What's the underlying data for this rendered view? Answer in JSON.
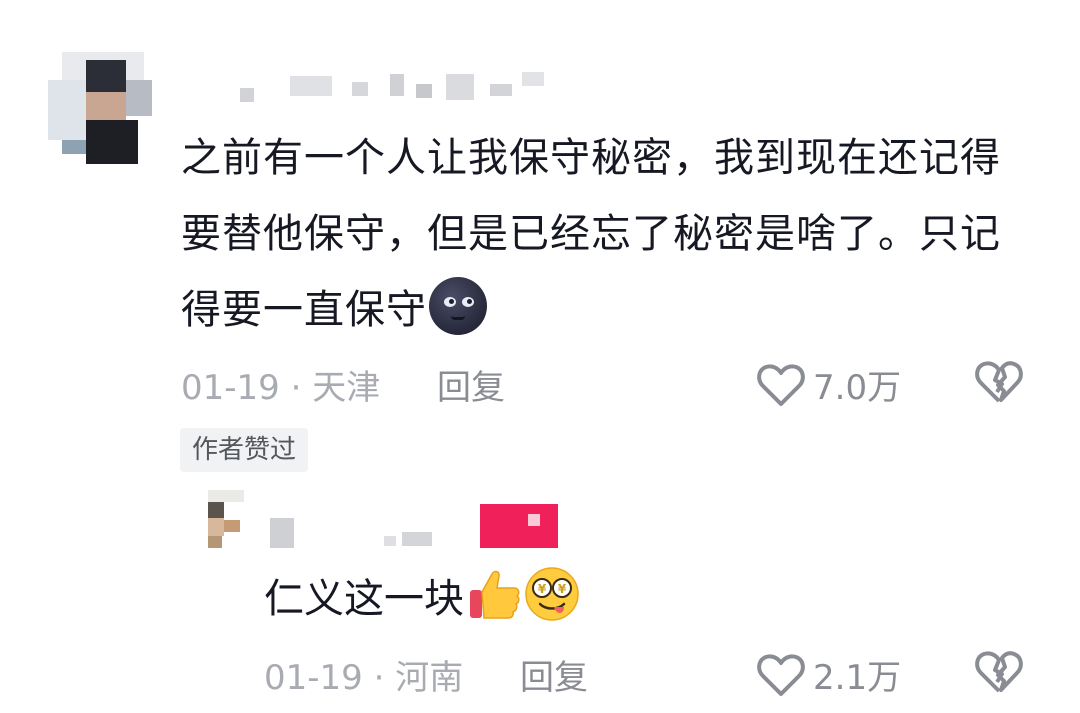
{
  "comment": {
    "text": "之前有一个人让我保守秘密，我到现在还记得要替他保守，但是已经忘了秘密是啥了。只记得要一直保守",
    "emoji_icon": "new-moon-face-icon",
    "date_location": "01-19 · 天津",
    "reply_label": "回复",
    "like_count": "7.0万",
    "author_badge": "作者赞过"
  },
  "reply": {
    "text": "仁义这一块",
    "emoji_icons": [
      "thumbs-up-icon",
      "money-eyes-face-icon"
    ],
    "date_location": "01-19 · 河南",
    "reply_label": "回复",
    "like_count": "2.1万"
  },
  "colors": {
    "text": "#161823",
    "meta": "#a9abb3",
    "action": "#8a8c94",
    "badge_bg": "#f1f2f4",
    "reply_name_tag": "#f0205a"
  }
}
